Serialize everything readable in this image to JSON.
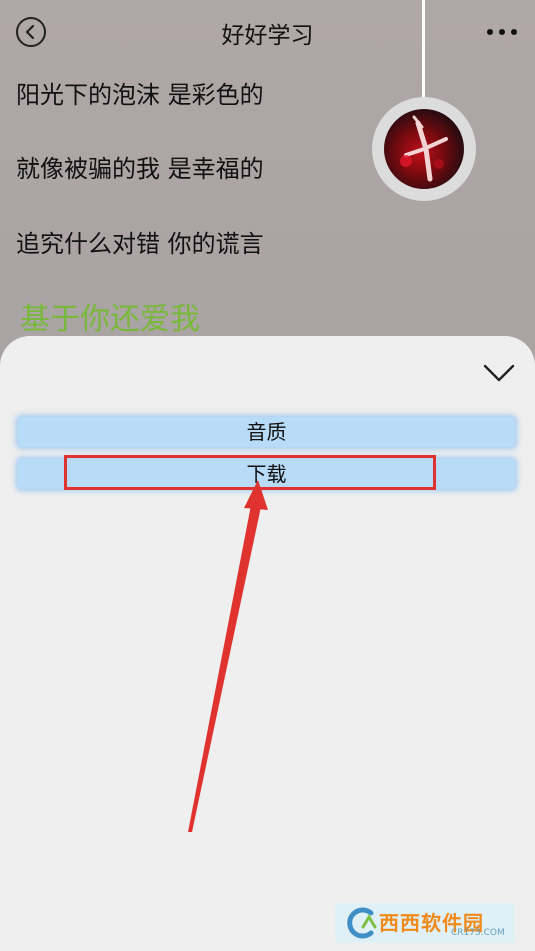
{
  "header": {
    "title": "好好学习",
    "back_icon": "back-arrow-icon",
    "more_icon": "more-dots-icon"
  },
  "player": {
    "album_icon": "album-cover-icon"
  },
  "lyrics": {
    "lines": [
      "阳光下的泡沫 是彩色的",
      "就像被骗的我 是幸福的",
      "追究什么对错 你的谎言"
    ],
    "current_line": "基于你还爱我",
    "current_color": "#78b83a"
  },
  "sheet": {
    "collapse_icon": "chevron-down-icon",
    "options": [
      {
        "label": "音质"
      },
      {
        "label": "下载"
      }
    ],
    "highlight_color": "#e0332f"
  },
  "watermark": {
    "brand": "西西软件园",
    "url": "CR173.COM"
  }
}
